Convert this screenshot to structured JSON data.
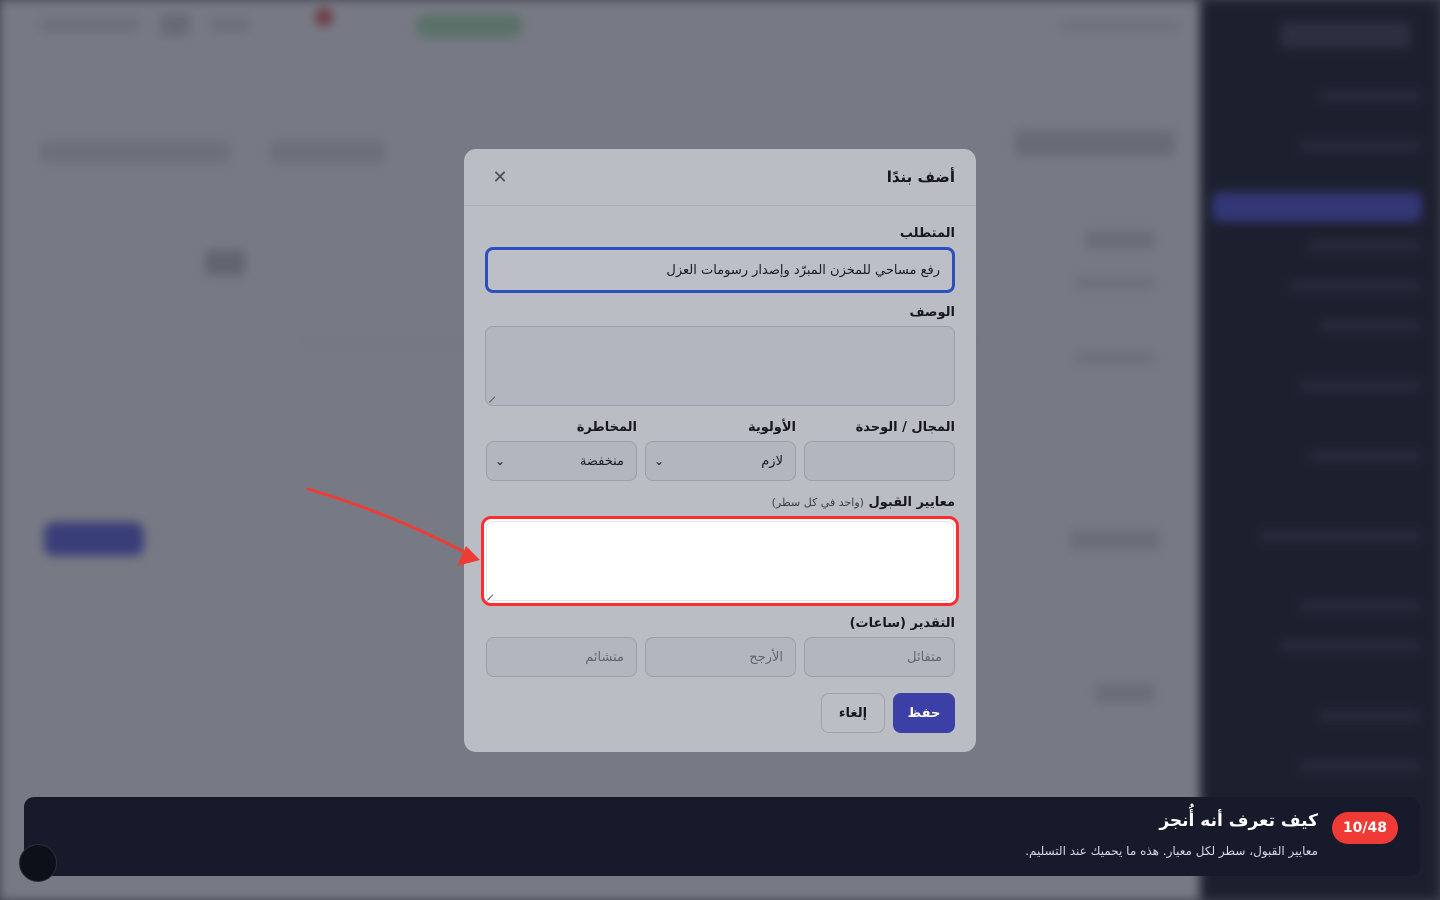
{
  "modal": {
    "title": "أضف بندًا",
    "close_icon": "close-icon",
    "requirement": {
      "label": "المتطلب",
      "value": "رفع مساحي للمخزن المبرّد وإصدار رسومات العزل"
    },
    "description": {
      "label": "الوصف",
      "value": ""
    },
    "domain": {
      "label": "المجال / الوحدة",
      "value": ""
    },
    "priority": {
      "label": "الأولوية",
      "value": "لازم"
    },
    "risk": {
      "label": "المخاطرة",
      "value": "منخفضة"
    },
    "acceptance": {
      "label": "معايير القبول",
      "hint": "(واحد في كل سطر)",
      "value": ""
    },
    "estimate": {
      "label": "التقدير (ساعات)",
      "optimistic": "متفائل",
      "likely": "الأرجح",
      "pessimistic": "متشائم"
    },
    "save_label": "حفظ",
    "cancel_label": "إلغاء"
  },
  "tour": {
    "step": "10/48",
    "title": "كيف تعرف أنه أُنجز",
    "subtitle": "معايير القبول، سطر لكل معيار. هذه ما يحميك عند التسليم."
  },
  "colors": {
    "primary": "#3c3fa6",
    "highlight": "#ff2d2d",
    "focus": "#2c4fbe",
    "tour_bg": "#161a2b",
    "badge": "#ef3a35"
  }
}
